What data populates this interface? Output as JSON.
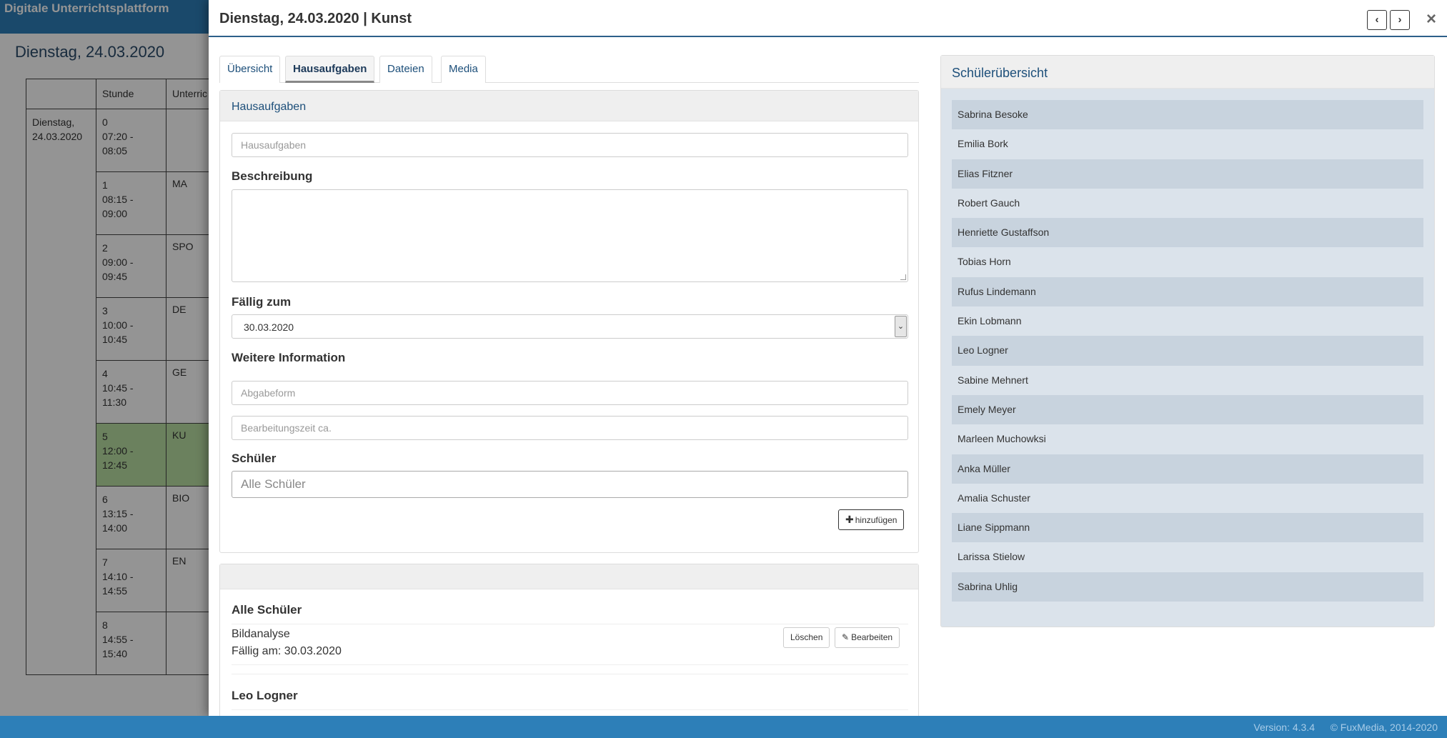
{
  "app": {
    "brand": "Digitale Unterrichtsplattform",
    "date_heading": "Dienstag, 24.03.2020",
    "table_headers": [
      "",
      "Stunde",
      "Unterric"
    ],
    "day_label": "Dienstag, 24.03.2020",
    "slots": [
      {
        "nr": "0",
        "time": "07:20 - 08:05",
        "subject": ""
      },
      {
        "nr": "1",
        "time": "08:15 - 09:00",
        "subject": "MA"
      },
      {
        "nr": "2",
        "time": "09:00 - 09:45",
        "subject": "SPO"
      },
      {
        "nr": "3",
        "time": "10:00 - 10:45",
        "subject": "DE"
      },
      {
        "nr": "4",
        "time": "10:45 - 11:30",
        "subject": "GE"
      },
      {
        "nr": "5",
        "time": "12:00 - 12:45",
        "subject": "KU"
      },
      {
        "nr": "6",
        "time": "13:15 - 14:00",
        "subject": "BIO"
      },
      {
        "nr": "7",
        "time": "14:10 - 14:55",
        "subject": "EN"
      },
      {
        "nr": "8",
        "time": "14:55 - 15:40",
        "subject": ""
      }
    ]
  },
  "footer": {
    "version": "Version: 4.3.4",
    "copyright": "© FuxMedia, 2014-2020"
  },
  "modal": {
    "title": "Dienstag, 24.03.2020 | Kunst",
    "prev_label": "‹",
    "next_label": "›",
    "close_label": "×",
    "tabs": [
      {
        "label": "Übersicht"
      },
      {
        "label": "Hausaufgaben"
      },
      {
        "label": "Dateien"
      },
      {
        "label": "Media"
      }
    ],
    "form": {
      "panel_title": "Hausaufgaben",
      "title_placeholder": "Hausaufgaben",
      "description_label": "Beschreibung",
      "due_label": "Fällig zum",
      "due_value": "30.03.2020",
      "more_info_label": "Weitere Information",
      "submission_placeholder": "Abgabeform",
      "duration_placeholder": "Bearbeitungszeit ca.",
      "students_label": "Schüler",
      "students_placeholder": "Alle Schüler",
      "add_label": "hinzufügen"
    },
    "list": {
      "groups": [
        {
          "title": "Alle Schüler",
          "task": "Bildanalyse",
          "due": "Fällig am: 30.03.2020",
          "delete_label": "Löschen",
          "edit_label": "Bearbeiten"
        },
        {
          "title": "Leo Logner"
        }
      ]
    },
    "student_overview": {
      "title": "Schülerübersicht",
      "students": [
        "Sabrina Besoke",
        "Emilia Bork",
        "Elias Fitzner",
        "Robert Gauch",
        "Henriette Gustaffson",
        "Tobias Horn",
        "Rufus Lindemann",
        "Ekin Lobmann",
        "Leo Logner",
        "Sabine Mehnert",
        "Emely Meyer",
        "Marleen Muchowksi",
        "Anka Müller",
        "Amalia Schuster",
        "Liane Sippmann",
        "Larissa Stielow",
        "Sabrina Uhlig"
      ]
    }
  }
}
